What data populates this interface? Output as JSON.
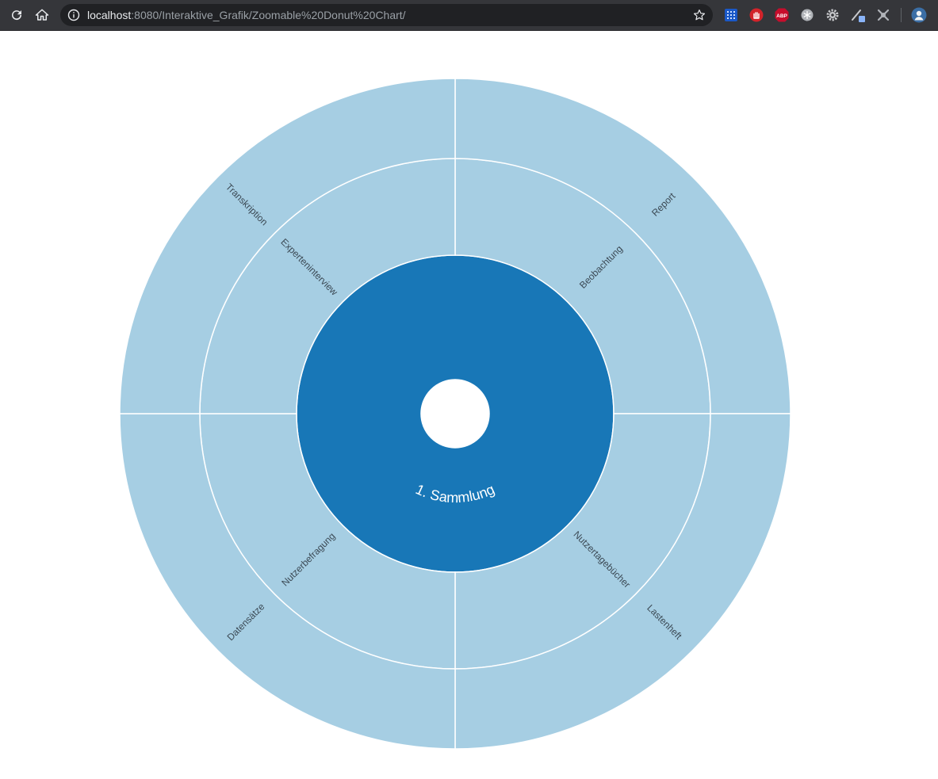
{
  "browser": {
    "url_host": "localhost",
    "url_rest": ":8080/Interaktive_Grafik/Zoomable%20Donut%20Chart/",
    "icons": [
      "reload-icon",
      "home-icon",
      "info-icon",
      "bookmark-star-icon"
    ],
    "extensions": [
      "grid-extension-icon",
      "hand-stop-extension-icon",
      "adblock-plus-icon",
      "snowflake-extension-icon",
      "gear-extension-icon",
      "pencil-extension-icon",
      "puzzle-extension-icon",
      "profile-avatar-icon"
    ]
  },
  "chart_data": {
    "type": "sunburst",
    "root": {
      "name": "1. Sammlung",
      "color": "#1877b7"
    },
    "ring2": [
      {
        "name": "Beobachtung",
        "start": 0,
        "end": 0.25
      },
      {
        "name": "Nutzertagebücher",
        "start": 0.25,
        "end": 0.5
      },
      {
        "name": "Nutzerbefragung",
        "start": 0.5,
        "end": 0.75
      },
      {
        "name": "Experteninterview",
        "start": 0.75,
        "end": 1.0
      }
    ],
    "ring3": [
      {
        "name": "Report",
        "start": 0,
        "end": 0.25
      },
      {
        "name": "Lastenheft",
        "start": 0.25,
        "end": 0.5
      },
      {
        "name": "Datensätze",
        "start": 0.5,
        "end": 0.75
      },
      {
        "name": "Transkription",
        "start": 0.75,
        "end": 1.0
      }
    ],
    "colors": {
      "inner": "#1877b7",
      "outer": "#a6cee3",
      "stroke": "#ffffff"
    }
  }
}
